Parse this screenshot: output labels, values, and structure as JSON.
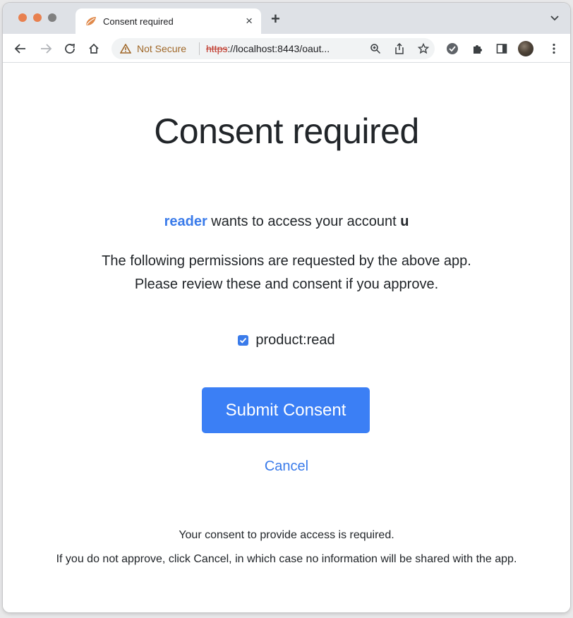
{
  "browser": {
    "tab_title": "Consent required",
    "tab_close": "×",
    "new_tab": "+",
    "security_label": "Not Secure",
    "url_scheme": "https",
    "url_rest": "://localhost:8443/oaut..."
  },
  "consent": {
    "title": "Consent required",
    "client_name": "reader",
    "client_text": " wants to access your account ",
    "account": "u",
    "desc_line1": "The following permissions are requested by the above app.",
    "desc_line2": "Please review these and consent if you approve.",
    "scope": "product:read",
    "scope_checked": true,
    "submit_label": "Submit Consent",
    "cancel_label": "Cancel",
    "note_line1": "Your consent to provide access is required.",
    "note_line2": "If you do not approve, click Cancel, in which case no information will be shared with the app."
  },
  "colors": {
    "accent": "#3b7ff5",
    "link": "#3a7bea",
    "warning": "#a06829"
  }
}
